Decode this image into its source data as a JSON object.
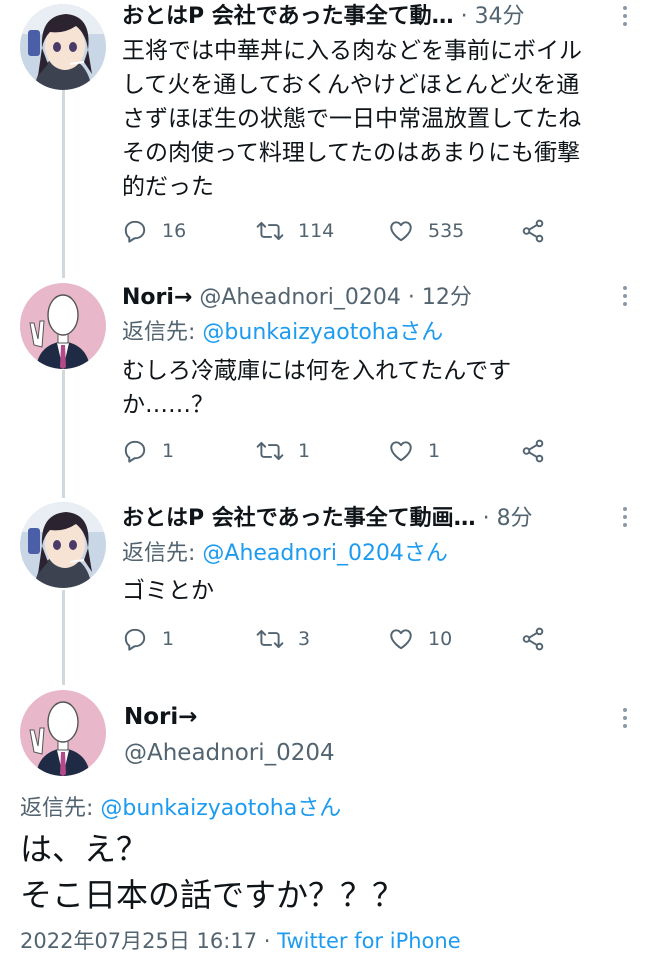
{
  "tweets": [
    {
      "name": "おとはP 会社であった事全て動…",
      "time": "34分",
      "lines": [
        "王将では中華丼に入る肉などを事前にボイル",
        "して火を通しておくんやけどほとんど火を通",
        "さずほぼ生の状態で一日中常温放置してたね",
        "その肉使って料理してたのはあまりにも衝撃",
        "的だった"
      ],
      "replies": "16",
      "retweets": "114",
      "likes": "535"
    },
    {
      "name": "Nori→",
      "handle": "@Aheadnori_0204",
      "time": "12分",
      "reply_label": "返信先: ",
      "reply_mention": "@bunkaizyaotohaさん",
      "lines": [
        "むしろ冷蔵庫には何を入れてたんです",
        "か……？"
      ],
      "replies": "1",
      "retweets": "1",
      "likes": "1"
    },
    {
      "name": "おとはP 会社であった事全て動画…",
      "time": "8分",
      "reply_label": "返信先: ",
      "reply_mention": "@Aheadnori_0204さん",
      "lines": [
        "ゴミとか"
      ],
      "replies": "1",
      "retweets": "3",
      "likes": "10"
    }
  ],
  "main_tweet": {
    "name": "Nori→",
    "handle": "@Aheadnori_0204",
    "reply_label": "返信先: ",
    "reply_mention": "@bunkaizyaotohaさん",
    "lines": [
      "は、え？",
      "そこ日本の話ですか？？？"
    ],
    "timestamp": "2022年07月25日 16:17",
    "separator": " · ",
    "source": "Twitter for iPhone"
  },
  "colors": {
    "accent": "#1d9bf0",
    "secondary_text": "#536471",
    "thread_line": "#cfd9de"
  },
  "icons": [
    "reply-icon",
    "retweet-icon",
    "like-icon",
    "share-icon",
    "more-icon"
  ]
}
